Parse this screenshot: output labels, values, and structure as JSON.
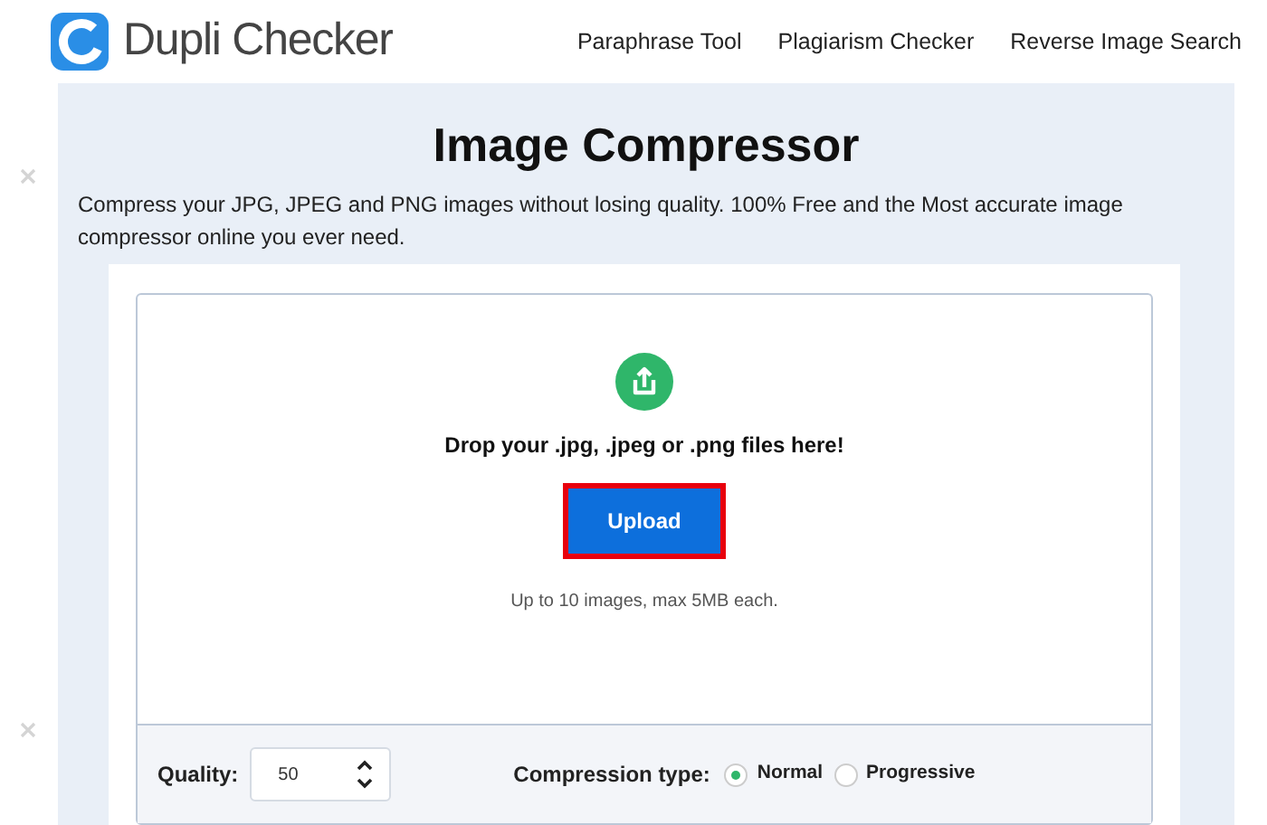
{
  "header": {
    "logo_text": "Dupli Checker",
    "nav": [
      "Paraphrase Tool",
      "Plagiarism Checker",
      "Reverse Image Search"
    ]
  },
  "title": "Image Compressor",
  "description": "Compress your JPG, JPEG and PNG images without losing quality. 100% Free and the Most accurate image compressor online you ever need.",
  "dropzone": {
    "prompt": "Drop your .jpg, .jpeg or .png files here!",
    "button": "Upload",
    "note": "Up to 10 images, max 5MB each."
  },
  "settings": {
    "quality_label": "Quality:",
    "quality_value": "50",
    "compression_label": "Compression type:",
    "options": [
      {
        "label": "Normal",
        "selected": true
      },
      {
        "label": "Progressive",
        "selected": false
      }
    ]
  }
}
